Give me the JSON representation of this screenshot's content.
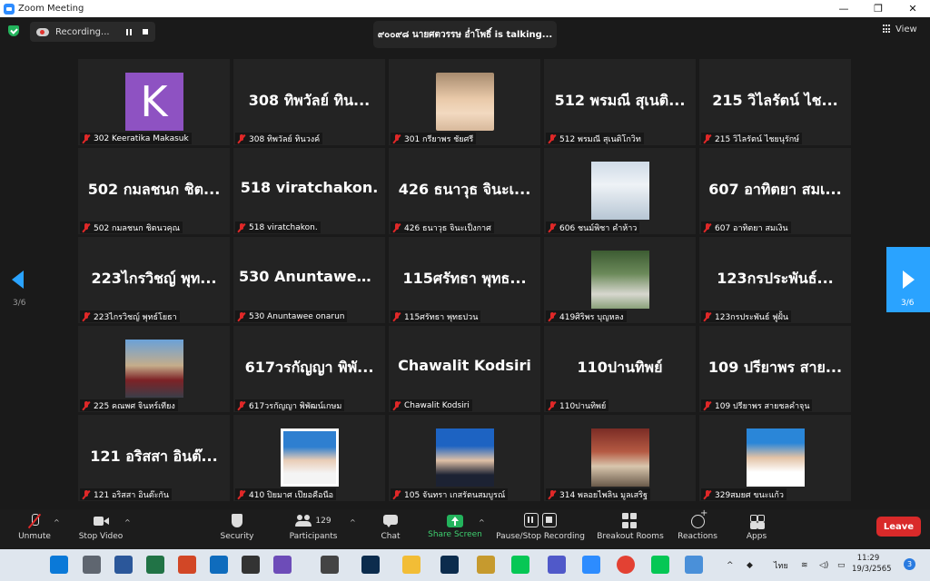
{
  "window": {
    "title": "Zoom Meeting",
    "controls": [
      "—",
      "❐",
      "✕"
    ]
  },
  "top_bar": {
    "recording_label": "Recording...",
    "talking_text": "๙๐๐๙๘ นายศตวรรษ อ่ำโพธิ์ is talking...",
    "view_label": "View"
  },
  "pagination": {
    "left_page": "3/6",
    "right_page": "3/6"
  },
  "tiles": [
    {
      "big": "",
      "avatar_letter": "K",
      "photo": "avatar-k",
      "name": "302 Keeratika Makasuk"
    },
    {
      "big": "308 ทิพวัลย์  ทิน...",
      "photo": "",
      "name": "308 ทิพวัลย์  ทินวงค์"
    },
    {
      "big": "",
      "photo": "ph-selfie",
      "name": "301 กรียาพร ชัยศรี"
    },
    {
      "big": "512 พรมณี สุเนติ...",
      "photo": "",
      "name": "512 พรมณี สุเนติโกวิท"
    },
    {
      "big": "215 วิไลรัตน์  ไช...",
      "photo": "",
      "name": "215 วิไลรัตน์  ไชยนุรักษ์"
    },
    {
      "big": "502 กมลชนก ชิต...",
      "photo": "",
      "name": "502 กมลชนก ชิตนวคุณ"
    },
    {
      "big": "518  viratchakon.",
      "photo": "",
      "name": "518  viratchakon."
    },
    {
      "big": "426 ธนาวุธ จินะเ...",
      "photo": "",
      "name": "426 ธนาวุธ จินะเป็งกาศ"
    },
    {
      "big": "",
      "photo": "ph-girl-white",
      "name": "606 ชนม์พิชา คำห้าว"
    },
    {
      "big": "607 อาทิตยา สมเ...",
      "photo": "",
      "name": "607 อาทิตยา สมเงิน"
    },
    {
      "big": "223ไกรวิชญ์  พุท...",
      "photo": "",
      "name": "223ไกรวิชญ์  พุทธ์โยธา"
    },
    {
      "big": "530  Anuntawee...",
      "photo": "",
      "name": "530 Anuntawee onarun"
    },
    {
      "big": "115ศรัทธา พุทธ...",
      "photo": "",
      "name": "115ศรัทธา พุทธปวน"
    },
    {
      "big": "",
      "photo": "ph-girl-green",
      "name": "419ศิริพร บุญหลง"
    },
    {
      "big": "123กรประพันธ์...",
      "photo": "",
      "name": "123กรประพันธ์ ฟูฝั้น"
    },
    {
      "big": "",
      "photo": "ph-boy-outdoor",
      "name": "225 คณพศ จินหร์เทียง"
    },
    {
      "big": "617วรกัญญา พิพั...",
      "photo": "",
      "name": "617วรกัญญา พิพัฒน์เกษม"
    },
    {
      "big": "Chawalit Kodsiri",
      "photo": "",
      "name": "Chawalit Kodsiri"
    },
    {
      "big": "110ปานทิพย์",
      "photo": "",
      "name": "110ปานทิพย์"
    },
    {
      "big": "109 ปรียาพร สาย...",
      "photo": "",
      "name": "109 ปรียาพร สายชลคำจุน"
    },
    {
      "big": "121 อริสสา อินต๊...",
      "photo": "",
      "name": "121 อริสสา อินต๊ะกัน"
    },
    {
      "big": "",
      "photo": "ph-id-blue",
      "name": "410 ปิยมาศ เป๊ยอคือนือ"
    },
    {
      "big": "",
      "photo": "ph-id-navy",
      "name": "105  จันทรา เกสรัตนสมบูรณ์"
    },
    {
      "big": "",
      "photo": "ph-temple",
      "name": "314 พลอยไพลิน มูลเสริฐ"
    },
    {
      "big": "",
      "photo": "ph-id-boy",
      "name": "329สมยศ ขนะแก้ว"
    }
  ],
  "toolbar": {
    "unmute": "Unmute",
    "stop_video": "Stop Video",
    "security": "Security",
    "participants": "Participants",
    "participants_count": "129",
    "chat": "Chat",
    "share_screen": "Share Screen",
    "pause_stop_recording": "Pause/Stop Recording",
    "breakout_rooms": "Breakout Rooms",
    "reactions": "Reactions",
    "apps": "Apps",
    "leave": "Leave",
    "share_color": "#23b35c",
    "leave_color": "#d92a2a"
  },
  "taskbar": {
    "language": "ไทย",
    "time": "11:29",
    "date": "19/3/2565",
    "notifications": "3",
    "apps": [
      "windows-icon",
      "task-view-icon",
      "word-icon",
      "excel-icon",
      "powerpoint-icon",
      "mail-icon",
      "qr-icon",
      "app-icon",
      "app2-icon",
      "photoshop-icon",
      "file-explorer-icon",
      "photoshop2-icon",
      "app3-icon",
      "line-icon",
      "teams-icon",
      "zoom-icon",
      "chrome-icon",
      "line2-icon",
      "app4-icon"
    ]
  }
}
